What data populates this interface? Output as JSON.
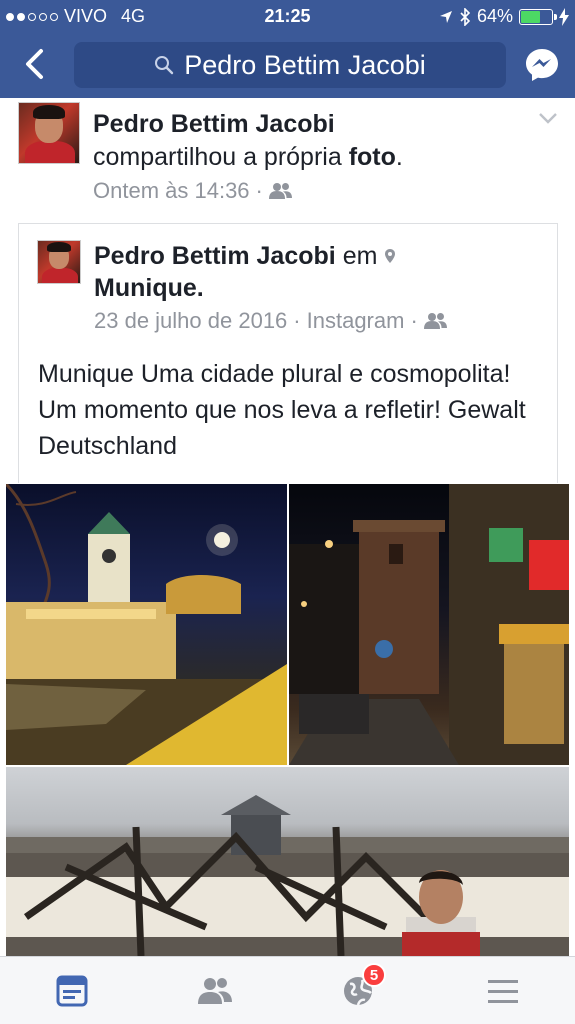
{
  "status_bar": {
    "carrier": "VIVO",
    "network": "4G",
    "time": "21:25",
    "battery_percent": "64%",
    "battery_level": 0.64,
    "signal_bars_full": 2,
    "signal_bars_total": 5
  },
  "nav": {
    "search_query": "Pedro Bettim Jacobi",
    "back_icon": "chevron-left-icon",
    "messenger_icon": "messenger-icon"
  },
  "story": {
    "author": "Pedro Bettim Jacobi",
    "action_prefix": "compartilhou a própria ",
    "action_bold": "foto",
    "action_suffix": ".",
    "timestamp": "Ontem às 14:36",
    "separator": "·",
    "privacy_icon": "friends-icon"
  },
  "shared_post": {
    "author": "Pedro Bettim Jacobi",
    "location_prefix": "em",
    "location": "Munique",
    "location_suffix": ".",
    "date": "23 de julho de 2016",
    "separator1": "·",
    "source": "Instagram",
    "separator2": "·",
    "privacy_icon": "friends-icon",
    "text": "Munique Uma cidade plural e cosmopolita! Um momento que nos leva a refletir! Gewalt Deutschland"
  },
  "tabbar": {
    "items": [
      {
        "name": "news-feed-icon",
        "active": true
      },
      {
        "name": "friend-requests-icon",
        "active": false
      },
      {
        "name": "notifications-icon",
        "active": false,
        "badge": "5"
      },
      {
        "name": "menu-icon",
        "active": false
      }
    ]
  },
  "colors": {
    "brand": "#3b5998",
    "meta_text": "#90949c",
    "badge": "#fa3e3e",
    "active_tab": "#4267b2",
    "inactive_tab": "#90949c"
  }
}
